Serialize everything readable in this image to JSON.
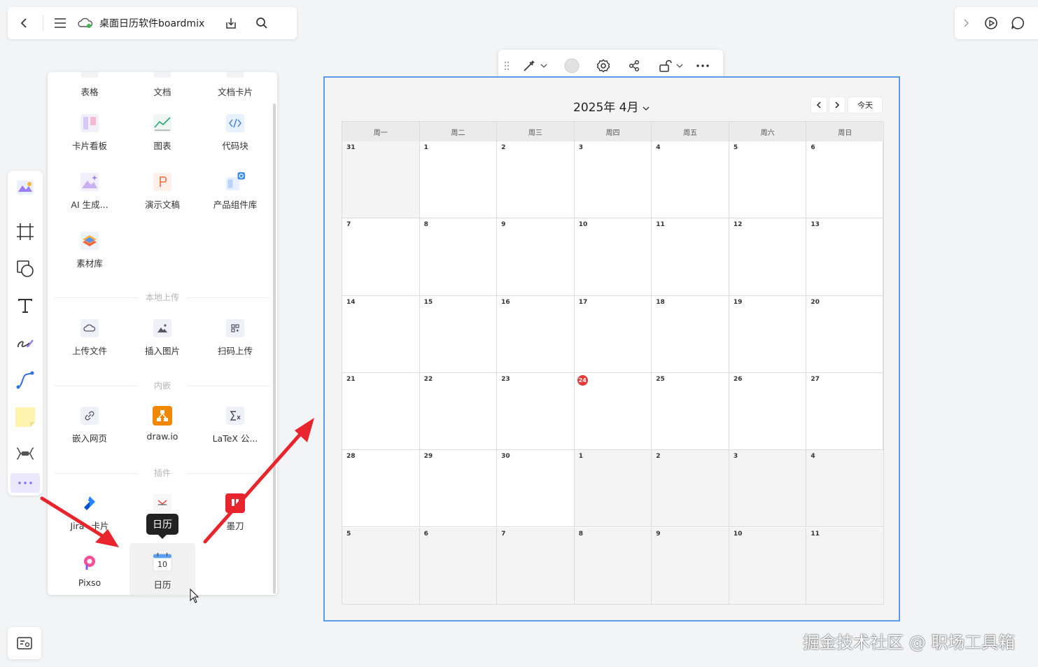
{
  "topbar": {
    "doc_title": "桌面日历软件boardmix"
  },
  "panel": {
    "row0": [
      "表格",
      "文档",
      "文档卡片"
    ],
    "row1": [
      "卡片看板",
      "图表",
      "代码块"
    ],
    "row2": [
      "AI 生成...",
      "演示文稿",
      "产品组件库"
    ],
    "row3": [
      "素材库"
    ],
    "section_upload": "本地上传",
    "upload": [
      "上传文件",
      "插入图片",
      "扫码上传"
    ],
    "section_embed": "内嵌",
    "embed": [
      "嵌入网页",
      "draw.io",
      "LaTeX 公..."
    ],
    "section_plugin": "插件",
    "plugins": [
      "Jira卡片",
      "",
      "墨刀"
    ],
    "plugin_partial_left": "Jira",
    "plugin_partial_right": "卡片",
    "plugins2": [
      "Pixso",
      "日历"
    ],
    "calendar_icon_number": "10",
    "tooltip": "日历"
  },
  "calendar": {
    "title": "2025年 4月",
    "today_button": "今天",
    "weekdays": [
      "周一",
      "周二",
      "周三",
      "周四",
      "周五",
      "周六",
      "周日"
    ],
    "weeks": [
      [
        "31",
        "1",
        "2",
        "3",
        "4",
        "5",
        "6"
      ],
      [
        "7",
        "8",
        "9",
        "10",
        "11",
        "12",
        "13"
      ],
      [
        "14",
        "15",
        "16",
        "17",
        "18",
        "19",
        "20"
      ],
      [
        "21",
        "22",
        "23",
        "24",
        "25",
        "26",
        "27"
      ],
      [
        "28",
        "29",
        "30",
        "1",
        "2",
        "3",
        "4"
      ],
      [
        "5",
        "6",
        "7",
        "8",
        "9",
        "10",
        "11"
      ]
    ],
    "today": "24"
  },
  "watermark": "掘金技术社区 @ 职场工具箱",
  "colors": {
    "accent": "#5a9bf0",
    "arrow": "#e8242c",
    "today": "#e53935"
  }
}
